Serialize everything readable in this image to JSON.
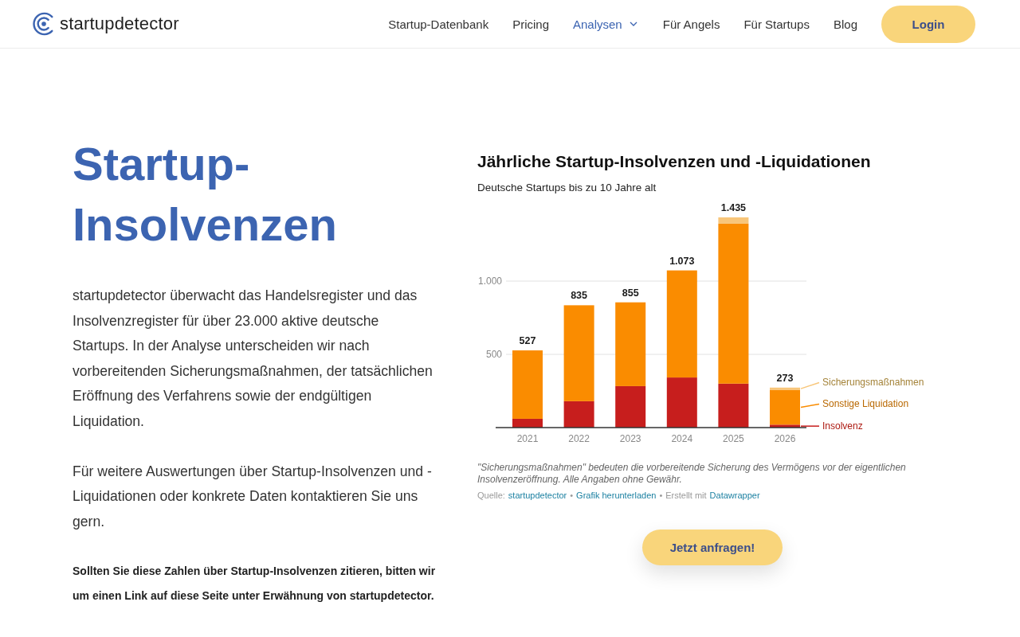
{
  "header": {
    "logo": "startupdetector",
    "nav": [
      {
        "label": "Startup-Datenbank",
        "selected": false,
        "dropdown": false
      },
      {
        "label": "Pricing",
        "selected": false,
        "dropdown": false
      },
      {
        "label": "Analysen",
        "selected": true,
        "dropdown": true
      },
      {
        "label": "Für Angels",
        "selected": false,
        "dropdown": false
      },
      {
        "label": "Für Startups",
        "selected": false,
        "dropdown": false
      },
      {
        "label": "Blog",
        "selected": false,
        "dropdown": false
      }
    ],
    "login_button": "Login"
  },
  "hero": {
    "title": "Startup-Insolvenzen",
    "paragraphs": [
      "startupdetector überwacht das Handelsregister und das Insolvenzregister für über 23.000 aktive deutsche Startups. In der Analyse unterscheiden wir nach vorbereitenden Sicherungsmaßnahmen, der tatsächlichen Eröffnung des Verfahrens sowie der endgültigen Liquidation.",
      "Für weitere Auswertungen über Startup-Insolvenzen und -Liquidationen oder konkrete Daten kontaktieren Sie uns gern."
    ],
    "citation_note": "Sollten Sie diese Zahlen über Startup-Insolvenzen zitieren, bitten wir um einen Link auf diese Seite unter Erwähnung von startupdetector."
  },
  "chart": {
    "subtitle": "Deutsche Startups bis zu 10 Jahre alt",
    "chart_data": {
      "type": "bar",
      "title": "Jährliche Startup-Insolvenzen und -Liquidationen",
      "categories": [
        "2021",
        "2022",
        "2023",
        "2024",
        "2025",
        "2026"
      ],
      "series": [
        {
          "name": "Insolvenz",
          "color": "#c71e1d",
          "values": [
            60,
            180,
            283,
            342,
            300,
            20
          ]
        },
        {
          "name": "Sonstige Liquidation",
          "color": "#fa8c00",
          "values": [
            467,
            655,
            572,
            731,
            1092,
            238
          ]
        },
        {
          "name": "Sicherungsmaßnahmen",
          "color": "#f8c67a",
          "values": [
            0,
            0,
            0,
            0,
            43,
            15
          ]
        }
      ],
      "stacked": true,
      "orientation": "vertical",
      "ylim": [
        0,
        1435
      ],
      "yticks": [
        {
          "value": 500,
          "label": "500"
        },
        {
          "value": 1000,
          "label": "1.000"
        }
      ],
      "value_labels": [
        "527",
        "835",
        "855",
        "1.073",
        "1.435",
        "273"
      ],
      "legend": "right"
    },
    "note": "\"Sicherungsmaßnahmen\" bedeuten die vorbereitende Sicherung des Vermögens vor der eigentlichen Insolvenzeröffnung. Alle Angaben ohne Gewähr.",
    "credits": [
      {
        "kind": "label",
        "text": "Quelle:"
      },
      {
        "kind": "link",
        "text": "startupdetector"
      },
      {
        "kind": "separator",
        "text": "•"
      },
      {
        "kind": "link",
        "text": "Grafik herunterladen"
      },
      {
        "kind": "separator",
        "text": "•"
      },
      {
        "kind": "label",
        "text": "Erstellt mit"
      },
      {
        "kind": "link",
        "text": "Datawrapper"
      }
    ]
  },
  "cta_button": "Jetzt anfragen!"
}
